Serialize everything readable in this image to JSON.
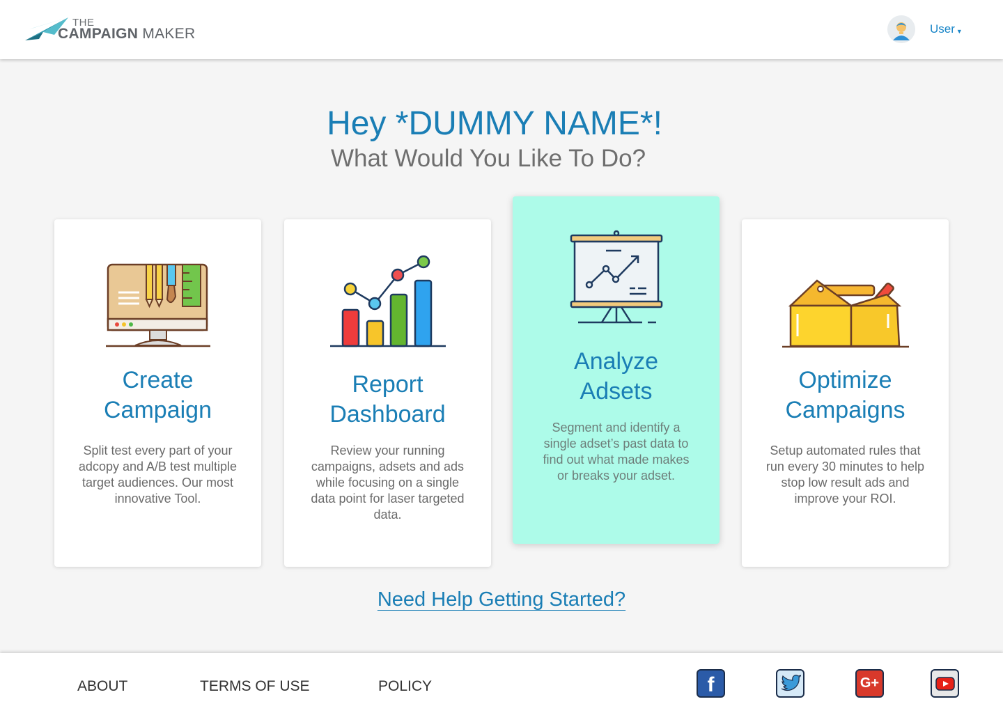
{
  "header": {
    "logo_the": "THE",
    "logo_campaign": "CAMPAIGN",
    "logo_maker": "MAKER",
    "user_label": "User",
    "caret_icon": "chevron-down-icon"
  },
  "hero": {
    "greeting": "Hey *DUMMY NAME*!",
    "subtitle": "What Would You Like To Do?"
  },
  "cards": [
    {
      "title_line1": "Create",
      "title_line2": "Campaign",
      "icon": "monitor-design-icon",
      "description": "Split test every part of your adcopy and A/B test multiple target audiences. Our most innovative Tool."
    },
    {
      "title_line1": "Report",
      "title_line2": "Dashboard",
      "icon": "bar-chart-icon",
      "description": "Review your running campaigns, adsets and ads while focusing on a single data point for laser targeted data."
    },
    {
      "title_line1": "Analyze",
      "title_line2": "Adsets",
      "icon": "presentation-board-icon",
      "description": "Segment and identify a single adset’s past data to find out what made makes or breaks your adset."
    },
    {
      "title_line1": "Optimize",
      "title_line2": "Campaigns",
      "icon": "toolbox-icon",
      "description": "Setup automated rules that run every 30 minutes to help stop low result ads and improve your ROI."
    }
  ],
  "help_link": "Need Help Getting Started?",
  "footer": {
    "links": [
      "ABOUT",
      "TERMS OF USE",
      "POLICY"
    ],
    "social_icons": [
      "facebook-icon",
      "twitter-icon",
      "google-plus-icon",
      "youtube-icon"
    ],
    "social_colors": {
      "facebook": "#2b5ba8",
      "twitter": "#d6e9f7",
      "google_plus": "#d8392b",
      "youtube": "#e8e8e8"
    }
  },
  "colors": {
    "accent": "#1a7eb5",
    "active_card": "#adfbe9",
    "background": "#f5f5f5"
  }
}
